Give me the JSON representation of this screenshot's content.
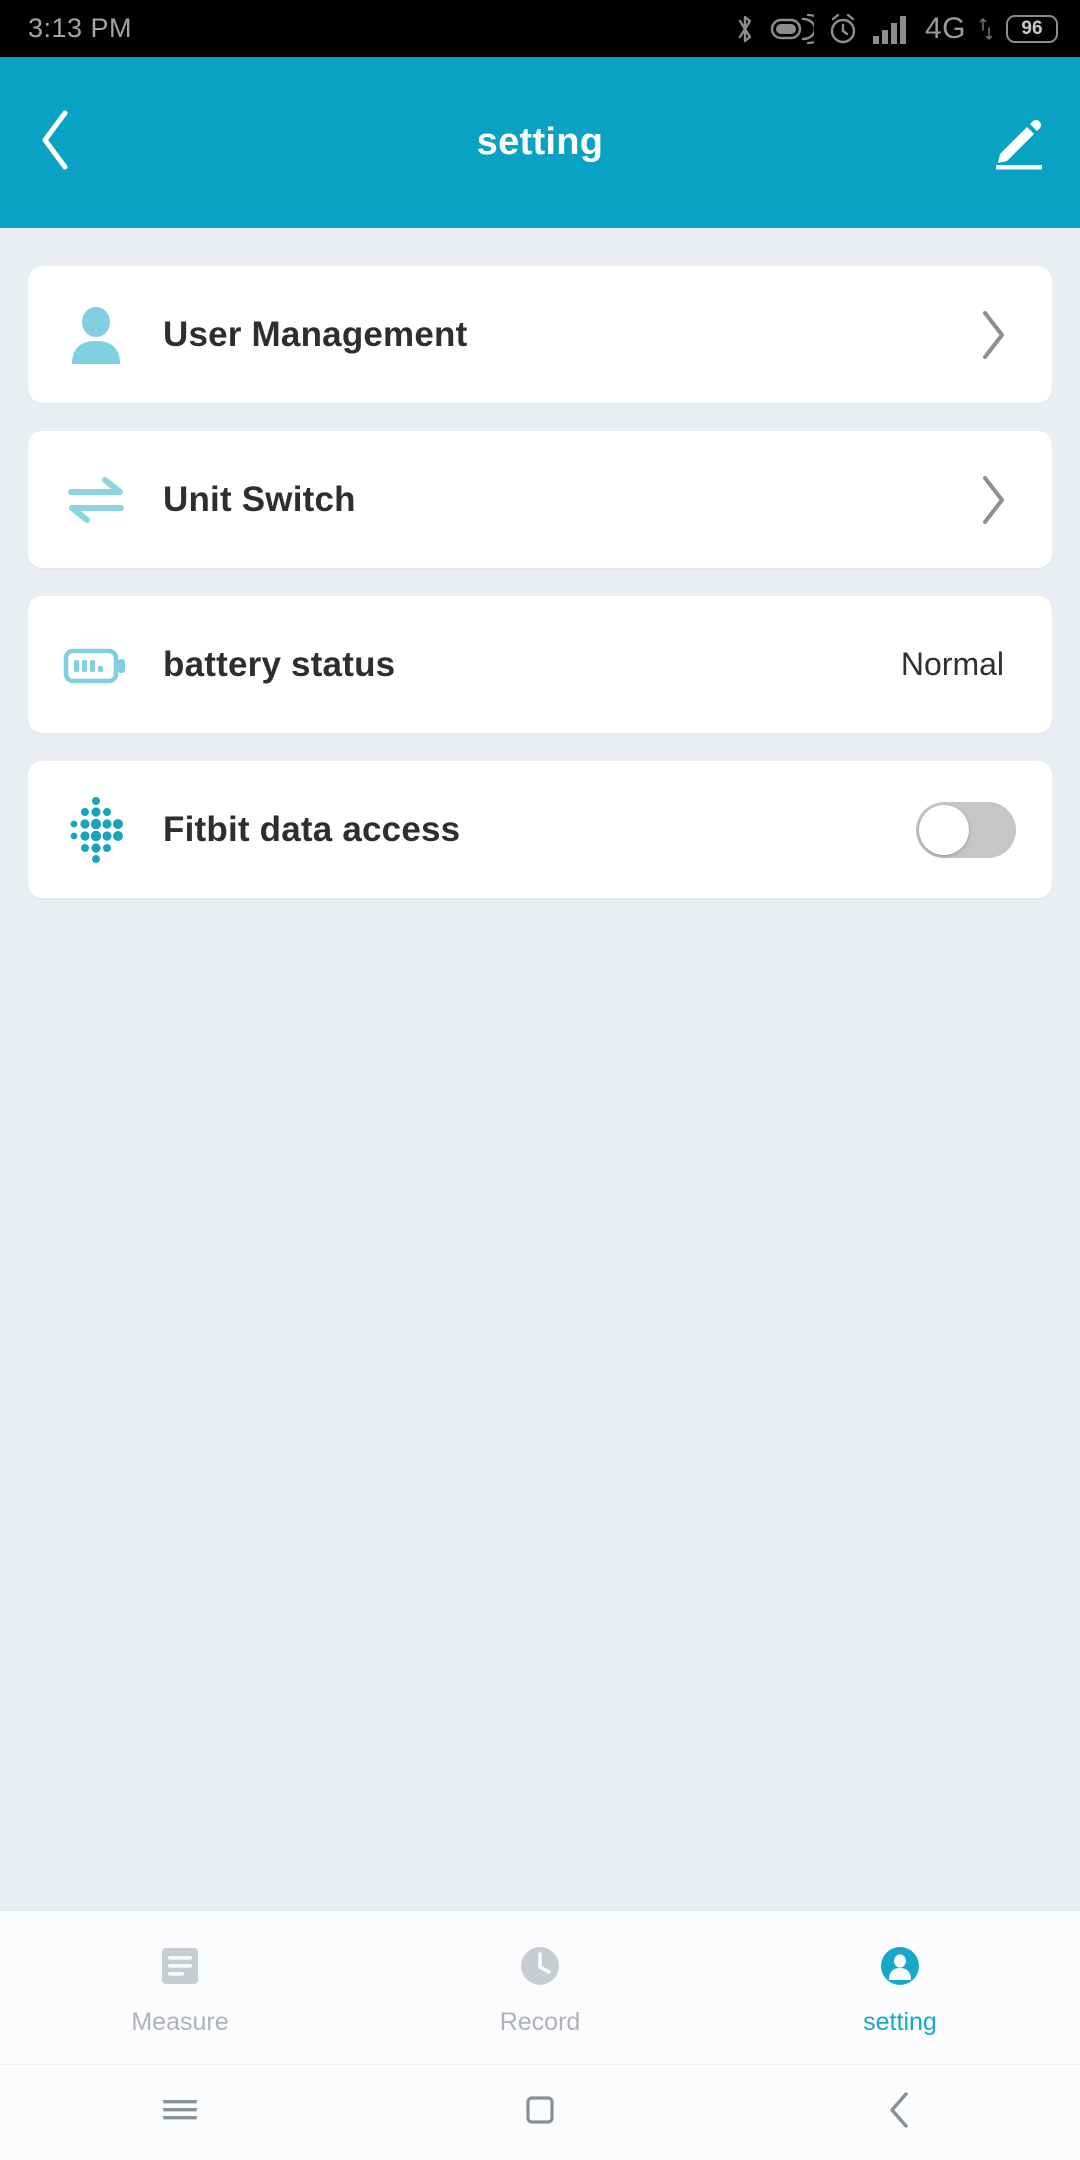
{
  "status_bar": {
    "time": "3:13 PM",
    "battery_percent": "96",
    "network_type": "4G",
    "icons": [
      "bluetooth-icon",
      "vibrate-icon",
      "alarm-icon",
      "signal-icon",
      "network-type-label",
      "data-arrows-icon",
      "battery-icon"
    ]
  },
  "app_bar": {
    "title": "setting",
    "back_icon": "chevron-left-icon",
    "edit_icon": "pencil-icon"
  },
  "settings_rows": [
    {
      "id": "user-management",
      "icon": "person-icon",
      "label": "User Management",
      "accessory": "chevron-right",
      "value": ""
    },
    {
      "id": "unit-switch",
      "icon": "swap-arrows-icon",
      "label": "Unit Switch",
      "accessory": "chevron-right",
      "value": ""
    },
    {
      "id": "battery-status",
      "icon": "battery-icon",
      "label": "battery status",
      "accessory": "value",
      "value": "Normal"
    },
    {
      "id": "fitbit-data-access",
      "icon": "fitbit-logo-icon",
      "label": "Fitbit data access",
      "accessory": "toggle",
      "value": "off"
    }
  ],
  "tab_bar": {
    "tabs": [
      {
        "id": "measure",
        "label": "Measure",
        "icon": "list-icon",
        "active": false
      },
      {
        "id": "record",
        "label": "Record",
        "icon": "clock-icon",
        "active": false
      },
      {
        "id": "setting",
        "label": "setting",
        "icon": "profile-icon",
        "active": true
      }
    ]
  },
  "nav_bar": {
    "buttons": [
      {
        "id": "menu",
        "icon": "menu-icon"
      },
      {
        "id": "home",
        "icon": "square-icon"
      },
      {
        "id": "back",
        "icon": "chevron-left-icon"
      }
    ]
  },
  "colors": {
    "accent": "#0aa2c4",
    "icon_blue": "#7fcfe0",
    "fitbit_teal": "#17a3b8",
    "page_bg": "#eaedf1",
    "card_bg": "#ffffff",
    "text_primary": "#2e2e2e",
    "text_muted": "#aeb2b6"
  }
}
